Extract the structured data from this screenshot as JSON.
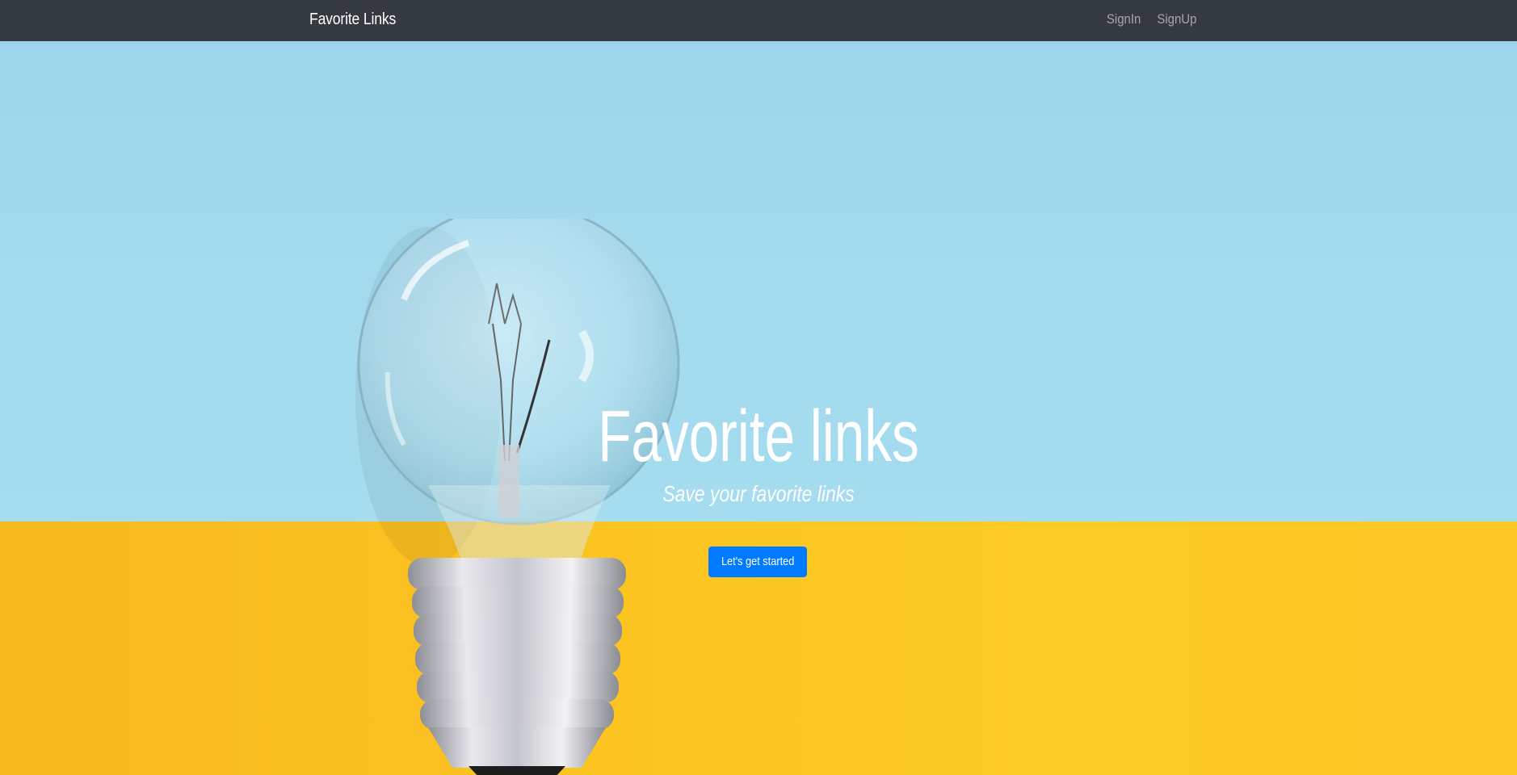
{
  "navbar": {
    "brand": "Favorite Links",
    "links": [
      {
        "label": "SignIn"
      },
      {
        "label": "SignUp"
      }
    ]
  },
  "hero": {
    "title": "Favorite links",
    "subtitle": "Save your favorite links",
    "cta_label": "Let's get started",
    "background_image": "light-bulb-icon"
  },
  "colors": {
    "navbar_bg": "#343a40",
    "sky": "#a3daee",
    "floor": "#fcc523",
    "button": "#007bff",
    "text": "#ffffff"
  }
}
